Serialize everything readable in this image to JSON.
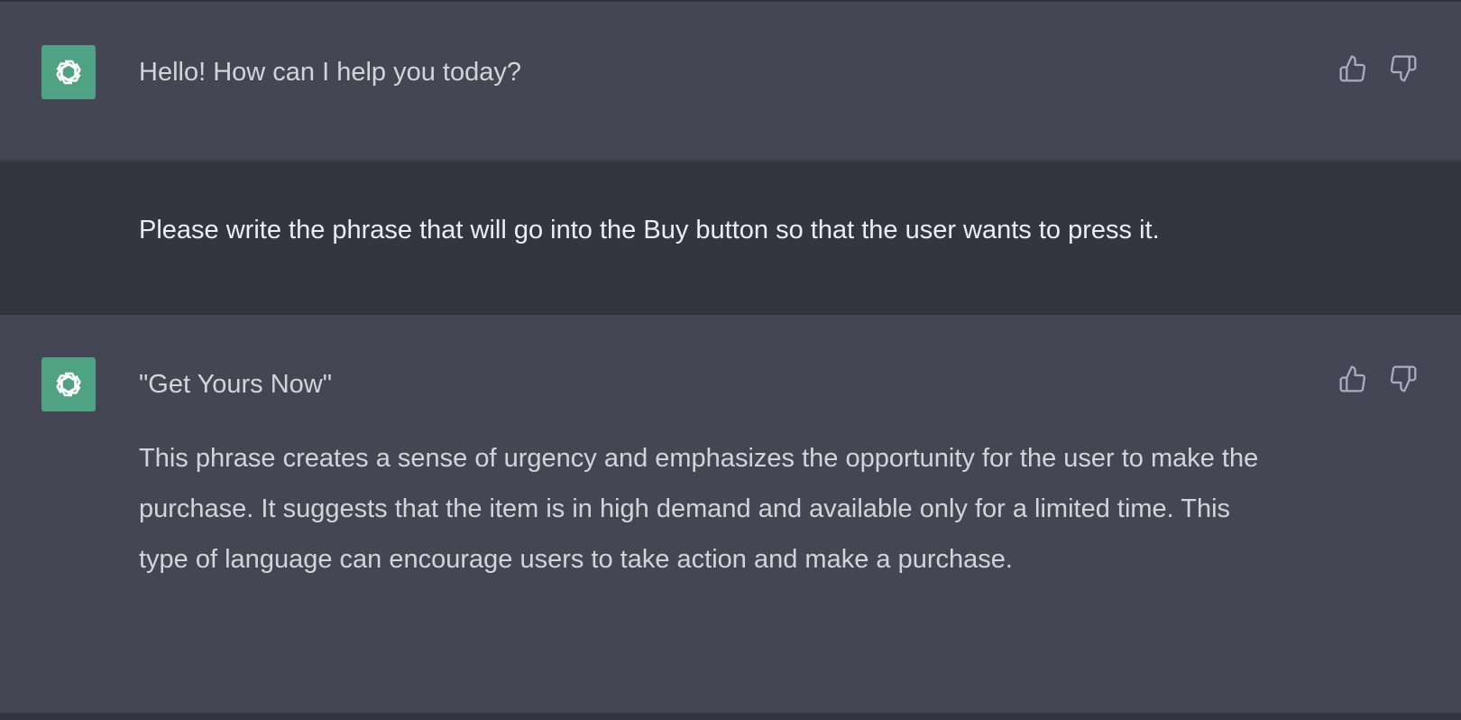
{
  "messages": [
    {
      "role": "assistant",
      "avatar_icon": "openai-logo-icon",
      "text": "Hello! How can I help you today?",
      "feedback": {
        "thumbs_up_icon": "thumbs-up-icon",
        "thumbs_down_icon": "thumbs-down-icon"
      }
    },
    {
      "role": "user",
      "avatar_icon": "pixelated-user-avatar",
      "text": "Please write the phrase that will go into the Buy button so that the user wants to press it."
    },
    {
      "role": "assistant",
      "avatar_icon": "openai-logo-icon",
      "text": "\"Get Yours Now\"",
      "paragraph": "This phrase creates a sense of urgency and emphasizes the opportunity for the user to make the purchase. It suggests that the item is in high demand and available only for a limited time. This type of language can encourage users to take action and make a purchase.",
      "feedback": {
        "thumbs_up_icon": "thumbs-up-icon",
        "thumbs_down_icon": "thumbs-down-icon"
      }
    }
  ],
  "colors": {
    "assistant_bg": "#444654",
    "user_bg": "#343541",
    "bot_avatar": "#4fa283",
    "text": "#d1d5db"
  }
}
